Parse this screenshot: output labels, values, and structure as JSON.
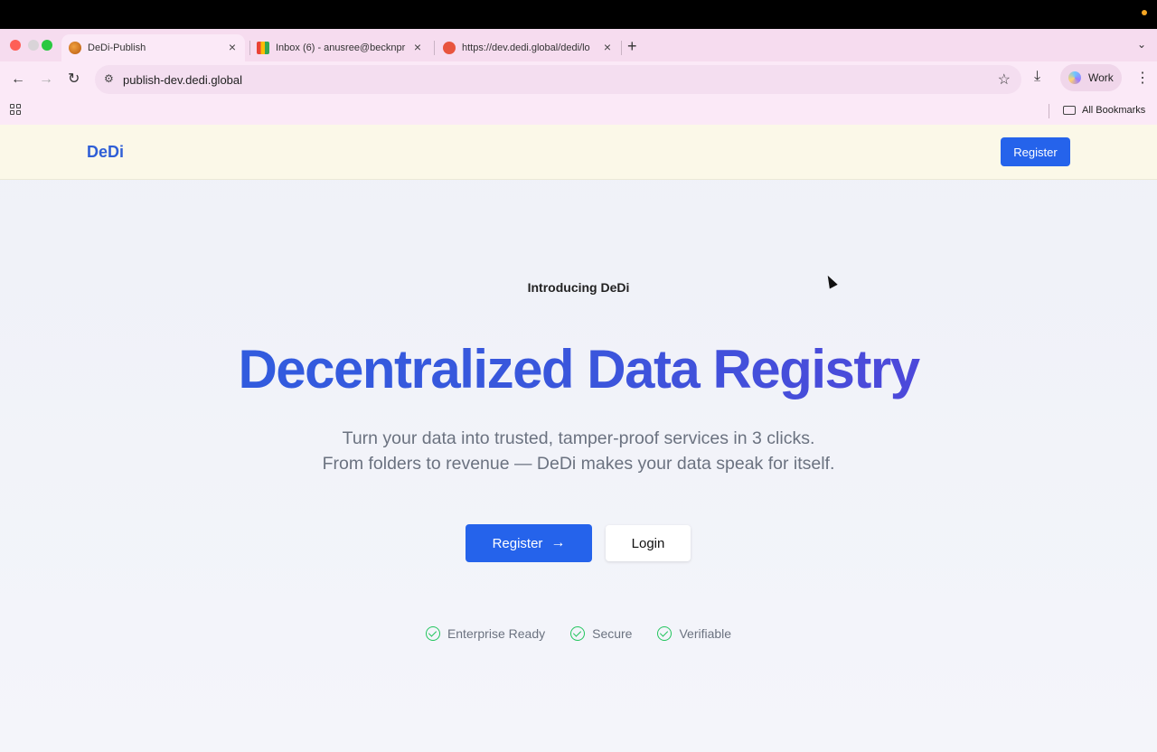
{
  "browser": {
    "tabs": [
      {
        "title": "DeDi-Publish",
        "active": true
      },
      {
        "title": "Inbox (6) - anusree@becknpr",
        "active": false
      },
      {
        "title": "https://dev.dedi.global/dedi/lo",
        "active": false
      }
    ],
    "url": "publish-dev.dedi.global",
    "profile_label": "Work",
    "bookmarks_label": "All Bookmarks"
  },
  "page": {
    "logo": "DeDi",
    "nav_register": "Register",
    "intro": "Introducing DeDi",
    "headline": "Decentralized Data Registry",
    "subtitle_line1": "Turn your data into trusted, tamper-proof services in 3 clicks.",
    "subtitle_line2": "From folders to revenue — DeDi makes your data speak for itself.",
    "cta_register": "Register",
    "cta_login": "Login",
    "features": [
      "Enterprise Ready",
      "Secure",
      "Verifiable"
    ]
  },
  "colors": {
    "primary": "#2563eb",
    "navbar_bg": "#fbf8e8",
    "check_green": "#22c55e"
  }
}
